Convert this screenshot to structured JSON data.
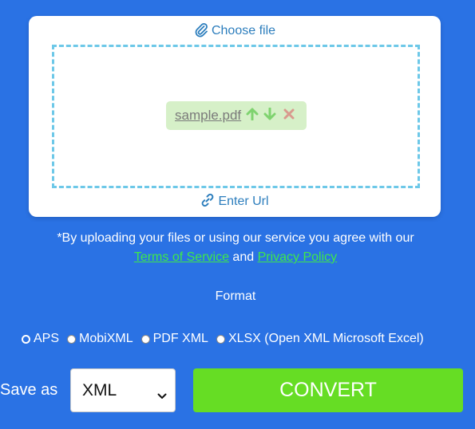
{
  "upload": {
    "choose_file_label": "Choose file",
    "enter_url_label": "Enter Url",
    "file": {
      "name": "sample.pdf"
    }
  },
  "agreement": {
    "text_before": "*By uploading your files or using our service you agree with our",
    "terms_link": "Terms of Service",
    "and_text": "and",
    "privacy_link": "Privacy Policy"
  },
  "format": {
    "label": "Format",
    "options": [
      {
        "label": "APS",
        "selected": true
      },
      {
        "label": "MobiXML",
        "selected": false
      },
      {
        "label": "PDF XML",
        "selected": false
      },
      {
        "label": "XLSX (Open XML Microsoft Excel)",
        "selected": false
      }
    ]
  },
  "save": {
    "label": "Save as",
    "selected_format": "XML"
  },
  "convert_label": "CONVERT",
  "colors": {
    "background": "#2a72e4",
    "link_green": "#3ee84a",
    "convert_green": "#66dd24",
    "chip_green": "#d6f0c8",
    "dashed_border": "#6dc8e8",
    "link_blue": "#2d7ebd"
  }
}
